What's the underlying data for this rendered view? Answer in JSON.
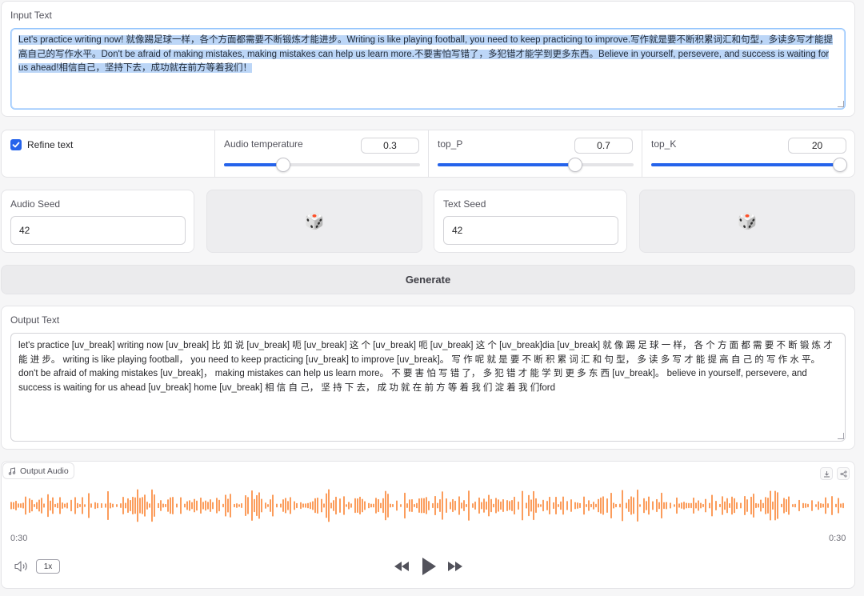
{
  "input_panel": {
    "label": "Input Text",
    "value": "Let's practice writing now! 就像踢足球一样，各个方面都需要不断锻炼才能进步。Writing is like playing football, you need to keep practicing to improve.写作就是要不断积累词汇和句型，多读多写才能提高自己的写作水平。Don't be afraid of making mistakes, making mistakes can help us learn more.不要害怕写错了，多犯错才能学到更多东西。Believe in yourself, persevere, and success is waiting for us ahead!相信自己，坚持下去，成功就在前方等着我们！"
  },
  "controls": {
    "refine_text": {
      "label": "Refine text",
      "checked": true
    },
    "audio_temperature": {
      "label": "Audio temperature",
      "value": "0.3",
      "fraction": 0.3
    },
    "top_p": {
      "label": "top_P",
      "value": "0.7",
      "fraction": 0.7
    },
    "top_k": {
      "label": "top_K",
      "value": "20",
      "fraction": 1.0
    }
  },
  "seeds": {
    "audio_seed": {
      "label": "Audio Seed",
      "value": "42"
    },
    "text_seed": {
      "label": "Text Seed",
      "value": "42"
    },
    "dice_icon": "🎲"
  },
  "generate": {
    "label": "Generate"
  },
  "output_panel": {
    "label": "Output Text",
    "value": "let's practice [uv_break] writing now [uv_break] 比 如 说 [uv_break] 呃 [uv_break] 这 个 [uv_break] 呃 [uv_break] 这 个 [uv_break]dia [uv_break] 就 像 踢 足 球 一 样， 各 个 方 面 都 需 要 不 断 锻 炼 才 能 进 步。 writing is like playing football， you need to keep practicing [uv_break] to improve [uv_break]。 写 作 呢 就 是 要 不 断 积 累 词 汇 和 句 型， 多 读 多 写 才 能 提 高 自 己 的 写 作 水 平。 don't be afraid of making mistakes [uv_break]， making mistakes can help us learn more。 不 要 害 怕 写 错 了， 多 犯 错 才 能 学 到 更 多 东 西 [uv_break]。 believe in yourself, persevere, and success is waiting for us ahead [uv_break] home [uv_break] 相 信 自 己， 坚 持 下 去， 成 功 就 在 前 方 等 着 我 们 淀 着 我 们ford"
  },
  "audio": {
    "label": "Output Audio",
    "current_time": "0:30",
    "duration": "0:30",
    "speed": "1x",
    "waveform_color": "#f97316",
    "icons": [
      "music-note-icon",
      "download-icon",
      "share-icon",
      "volume-icon",
      "rewind-icon",
      "play-icon",
      "fast-forward-icon"
    ]
  },
  "colors": {
    "accent": "#2563eb",
    "selection": "#bcd6f7"
  }
}
